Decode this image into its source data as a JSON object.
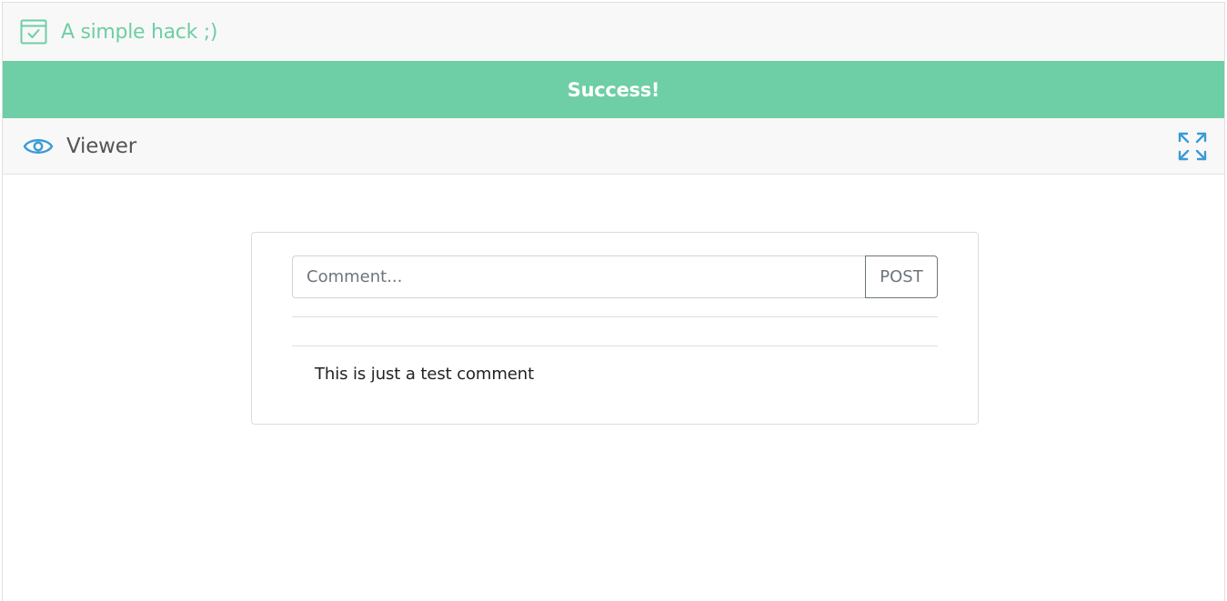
{
  "app": {
    "title": "A simple hack ;)",
    "icon": "calendar-check-icon",
    "accent_color": "#6ecea5"
  },
  "alert": {
    "message": "Success!",
    "color": "#6ecea5"
  },
  "viewer": {
    "label": "Viewer",
    "icon": "eye-icon",
    "expand_icon": "expand-icon",
    "icon_color": "#3a9bd5"
  },
  "comment_form": {
    "placeholder": "Comment...",
    "value": "",
    "post_label": "POST"
  },
  "comments": [
    {
      "text": "This is just a test comment"
    }
  ]
}
